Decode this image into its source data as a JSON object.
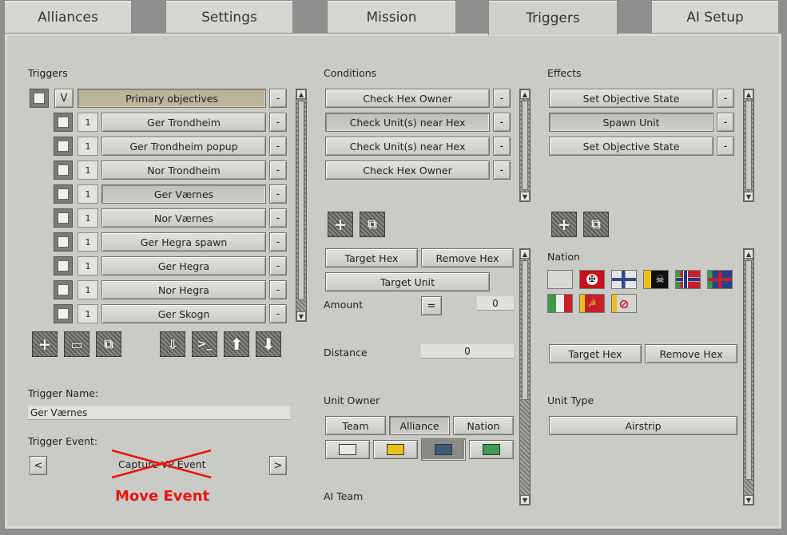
{
  "tabs": [
    {
      "label": "Alliances"
    },
    {
      "label": "Settings"
    },
    {
      "label": "Mission"
    },
    {
      "label": "Triggers"
    },
    {
      "label": "AI Setup"
    }
  ],
  "triggers": {
    "heading": "Triggers",
    "header": {
      "flag": "V",
      "label": "Primary objectives"
    },
    "rows": [
      {
        "num": "1",
        "label": "Ger Trondheim"
      },
      {
        "num": "1",
        "label": "Ger Trondheim popup"
      },
      {
        "num": "1",
        "label": "Nor Trondheim"
      },
      {
        "num": "1",
        "label": "Ger Værnes"
      },
      {
        "num": "1",
        "label": "Nor Værnes"
      },
      {
        "num": "1",
        "label": "Ger Hegra spawn"
      },
      {
        "num": "1",
        "label": "Ger Hegra"
      },
      {
        "num": "1",
        "label": "Nor Hegra"
      },
      {
        "num": "1",
        "label": "Ger Skogn"
      }
    ],
    "remove_label": "-",
    "name_label": "Trigger Name:",
    "name_value": "Ger Værnes",
    "event_label": "Trigger Event:",
    "event_prev": "<",
    "event_next": ">",
    "event_value": "Capture VP Event",
    "annotation": "Move Event"
  },
  "conditions": {
    "heading": "Conditions",
    "items": [
      {
        "label": "Check Hex Owner"
      },
      {
        "label": "Check Unit(s) near Hex"
      },
      {
        "label": "Check Unit(s) near Hex"
      },
      {
        "label": "Check Hex Owner"
      }
    ],
    "target_hex": "Target Hex",
    "remove_hex": "Remove Hex",
    "target_unit": "Target Unit",
    "amount_label": "Amount",
    "amount_op": "=",
    "amount_value": "0",
    "distance_label": "Distance",
    "distance_value": "0",
    "unit_owner_label": "Unit Owner",
    "owner_tabs": [
      {
        "label": "Team"
      },
      {
        "label": "Alliance"
      },
      {
        "label": "Nation"
      }
    ],
    "swatch_colors": [
      "#e8e8e8",
      "#e8c21a",
      "#3d5a77",
      "#3f9a52"
    ],
    "ai_team_label": "AI Team"
  },
  "effects": {
    "heading": "Effects",
    "items": [
      {
        "label": "Set Objective State"
      },
      {
        "label": "Spawn Unit"
      },
      {
        "label": "Set Objective State"
      }
    ],
    "nation_label": "Nation",
    "flags": [
      "neutral",
      "germany",
      "finland",
      "pirate",
      "norway",
      "uk",
      "italy",
      "soviet",
      "none"
    ],
    "target_hex": "Target Hex",
    "remove_hex": "Remove Hex",
    "unit_type_label": "Unit Type",
    "unit_type_value": "Airstrip"
  }
}
